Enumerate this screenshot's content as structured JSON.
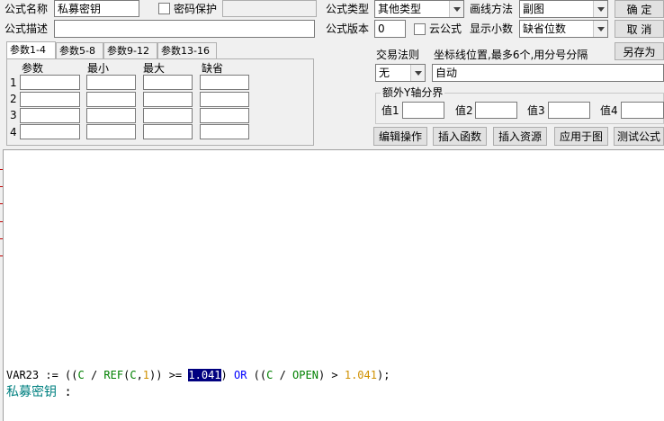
{
  "form": {
    "name_label": "公式名称",
    "name_value": "私募密钥",
    "password_label": "密码保护",
    "desc_label": "公式描述",
    "type_label": "公式类型",
    "type_value": "其他类型",
    "draw_label": "画线方法",
    "draw_value": "副图",
    "version_label": "公式版本",
    "version_value": "0",
    "cloud_label": "云公式",
    "decimal_label": "显示小数",
    "decimal_value": "缺省位数"
  },
  "buttons": {
    "ok": "确  定",
    "cancel": "取  消",
    "save_as": "另存为",
    "edit_op": "编辑操作",
    "insert_func": "插入函数",
    "insert_res": "插入资源",
    "apply_chart": "应用于图",
    "test_formula": "测试公式"
  },
  "tabs": [
    "参数1-4",
    "参数5-8",
    "参数9-12",
    "参数13-16"
  ],
  "params": {
    "headers": [
      "参数",
      "最小",
      "最大",
      "缺省"
    ],
    "rows": [
      "1",
      "2",
      "3",
      "4"
    ]
  },
  "trade": {
    "label": "交易法则",
    "value": "无",
    "coord_label": "坐标线位置,最多6个,用分号分隔",
    "coord_value": "自动"
  },
  "yaxis": {
    "title": "额外Y轴分界",
    "v1": "值1",
    "v2": "值2",
    "v3": "值3",
    "v4": "值4"
  },
  "code": {
    "line1": {
      "p1": "VAR23 := ((",
      "p2": "C",
      "p3": " / ",
      "p4": "REF",
      "p5": "(",
      "p6": "C",
      "p7": ",",
      "p8": "1",
      "p9": ")) >= ",
      "p10": "1.041",
      "p11": ") ",
      "p12": "OR",
      "p13": " ((",
      "p14": "C",
      "p15": " / ",
      "p16": "OPEN",
      "p17": ") > ",
      "p18": "1.041",
      "p19": ");"
    },
    "line2": {
      "name": "私募密钥",
      "rest": " :"
    }
  },
  "colors": {
    "keyword": "#0000ff",
    "function": "#008000",
    "number": "#d09000",
    "name": "#008080"
  }
}
